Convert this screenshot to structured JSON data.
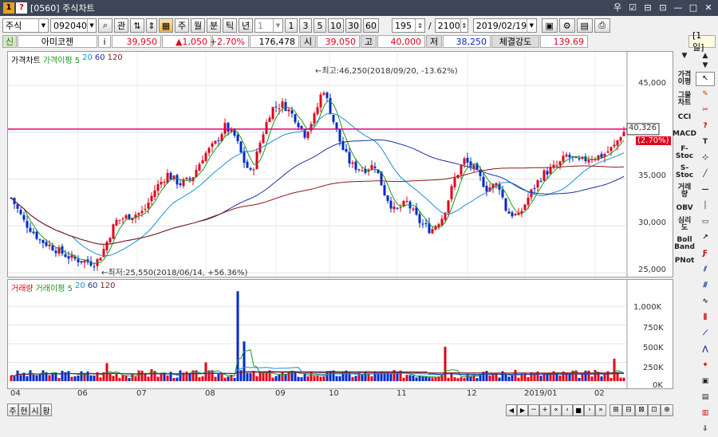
{
  "window": {
    "title": "[0560] 주식차트",
    "controls": [
      "우",
      "☑",
      "⊟",
      "⊡",
      "—",
      "□",
      "✕"
    ]
  },
  "toolbar": {
    "market": "주식",
    "code": "092040",
    "search_icon": "magnifier-icon",
    "relate_label": "관",
    "period_buttons": [
      "주",
      "월",
      "분",
      "틱",
      "년"
    ],
    "interval_value": "1",
    "minute_buttons": [
      "1",
      "3",
      "5",
      "10",
      "30",
      "60"
    ],
    "count_value": "195",
    "separator": "/",
    "total_value": "2100",
    "date_value": "2019/02/19"
  },
  "quote": {
    "badge": "신",
    "name": "아미코젠",
    "info_button": "i",
    "price": "39,950",
    "change": "▲1,050",
    "change_pct": "+2.70%",
    "volume": "176,478",
    "open_label": "시",
    "open": "39,050",
    "high_label": "고",
    "high": "40,000",
    "low_label": "저",
    "low": "38,250",
    "strength_label": "체결강도",
    "strength": "139.69",
    "period_tag": "[1일]"
  },
  "price_panel": {
    "legend": [
      {
        "text": "가격차트",
        "color": "#000000"
      },
      {
        "text": "가격이평 5",
        "color": "#1a9a1a"
      },
      {
        "text": "20",
        "color": "#1a8fd8"
      },
      {
        "text": "60",
        "color": "#1a2fa0"
      },
      {
        "text": "120",
        "color": "#8a1a1a"
      }
    ],
    "y_ticks": [
      "45,000",
      "40,000",
      "35,000",
      "30,000",
      "25,000"
    ],
    "high_annotation": "←최고:46,250(2018/09/20, -13.62%)",
    "low_annotation": "←최저:25,550(2018/06/14, +56.36%)",
    "current_price_tag": "40,326",
    "current_pct_tag": "(2.70%)",
    "reference_line_value": 40326
  },
  "volume_panel": {
    "legend": [
      {
        "text": "거래량",
        "color": "#e0001a"
      },
      {
        "text": "거래이평 5",
        "color": "#1a9a1a"
      },
      {
        "text": "20",
        "color": "#1a8fd8"
      },
      {
        "text": "60",
        "color": "#1a2fa0"
      },
      {
        "text": "120",
        "color": "#8a1a1a"
      }
    ],
    "y_ticks": [
      "1,000K",
      "750K",
      "500K",
      "250K",
      "0K"
    ]
  },
  "x_axis": [
    "04",
    "06",
    "07",
    "08",
    "09",
    "10",
    "11",
    "12",
    "2019/01",
    "02"
  ],
  "bottom": {
    "tabs": [
      "주",
      "현",
      "시",
      "황"
    ],
    "controls": [
      "◀",
      "▶",
      "−",
      "+",
      "«",
      "‹",
      "■",
      "›",
      "»",
      "⊞",
      "⊟",
      "⊠",
      "⊡",
      "⊕"
    ]
  },
  "side_tools": {
    "text_buttons": [
      "가격이평",
      "그물차트",
      "CCI",
      "MACD",
      "F-Stoc",
      "S-Stoc",
      "거래량",
      "OBV",
      "심리도",
      "Boll Band",
      "PNot"
    ]
  },
  "colors": {
    "up": "#e0001a",
    "down": "#0029c8",
    "ma5": "#1a9a1a",
    "ma20": "#1a8fd8",
    "ma60": "#1a2fa0",
    "ma120": "#8a1a1a",
    "ref_line": "#e8007d"
  }
}
